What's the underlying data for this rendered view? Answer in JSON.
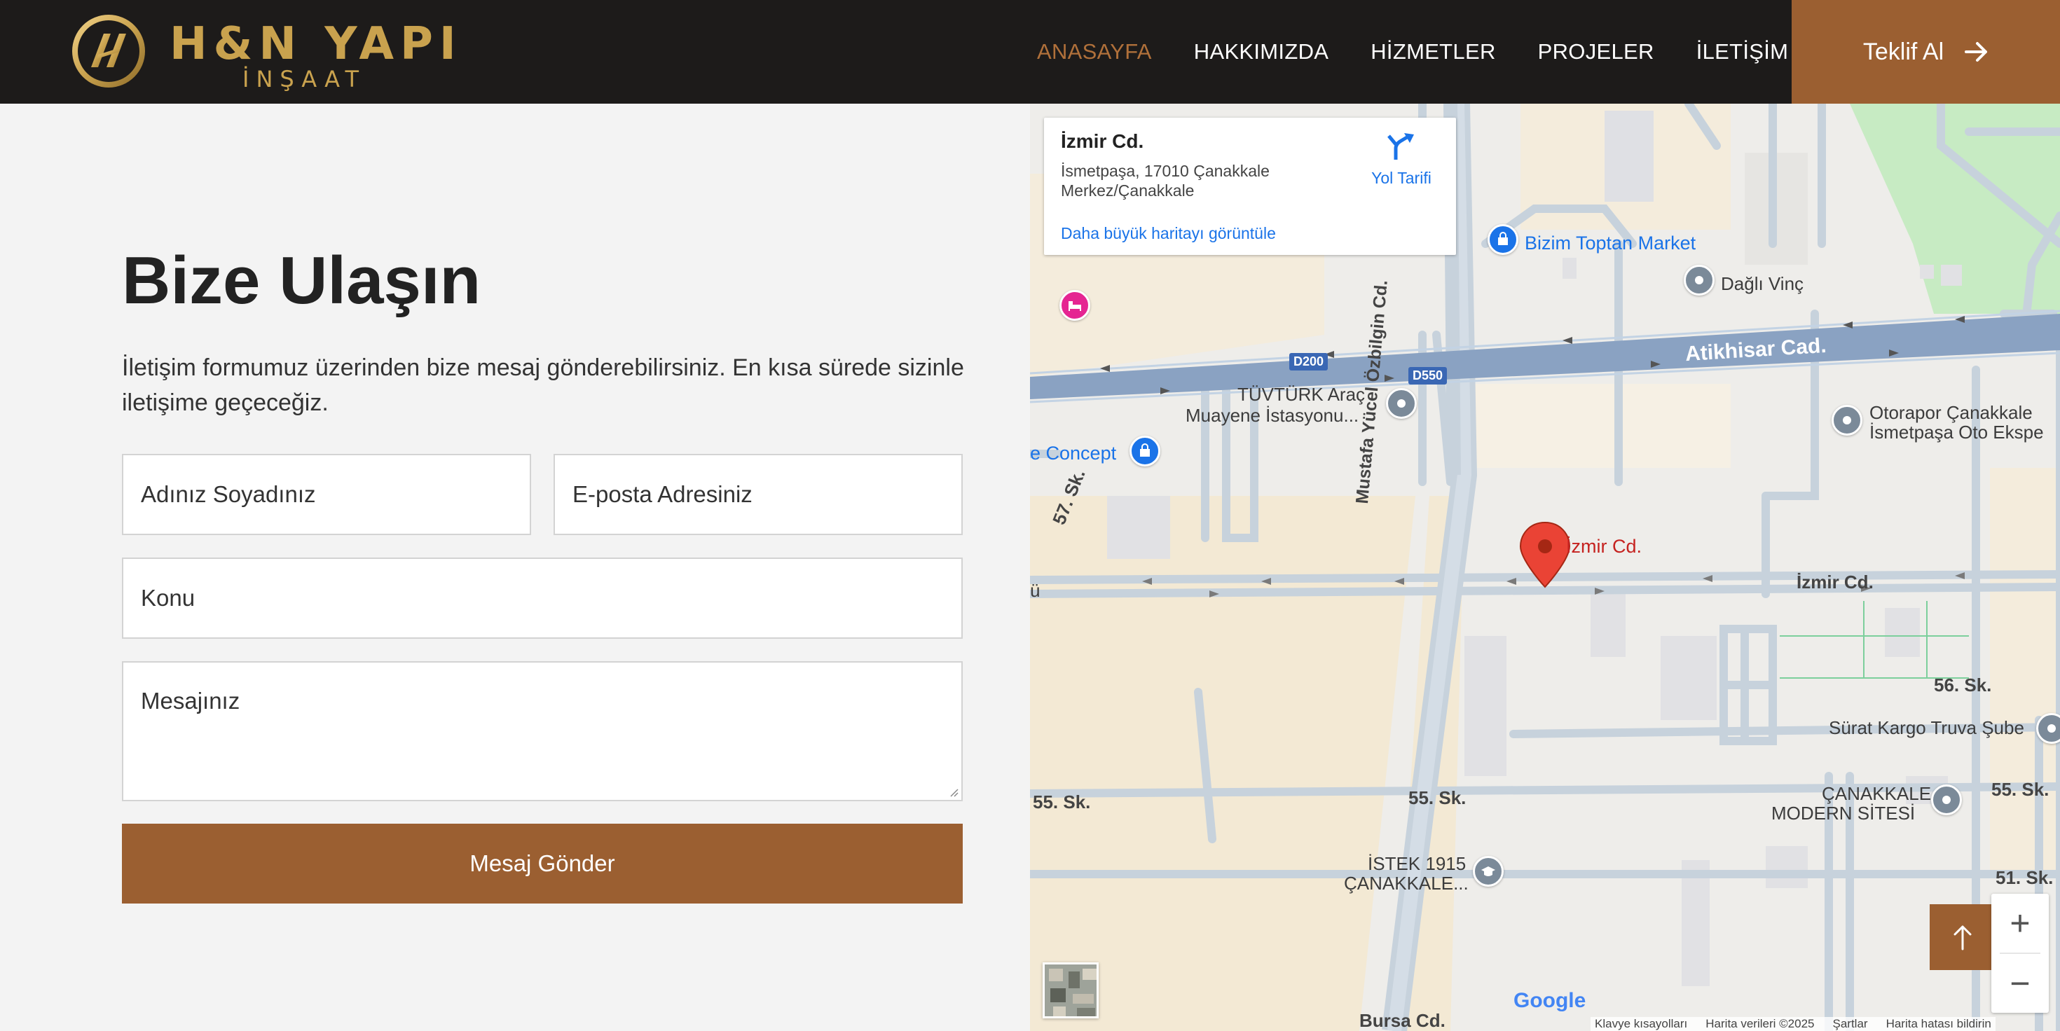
{
  "header": {
    "logo": {
      "title": "H&N YAPI",
      "subtitle": "İNŞAAT"
    },
    "nav": [
      {
        "label": "ANASAYFA",
        "active": true
      },
      {
        "label": "HAKKIMIZDA",
        "active": false
      },
      {
        "label": "HİZMETLER",
        "active": false
      },
      {
        "label": "PROJELER",
        "active": false
      },
      {
        "label": "İLETİŞİM",
        "active": false
      }
    ],
    "cta_label": "Teklif Al",
    "cta_icon": "arrow-right-icon"
  },
  "contact": {
    "title": "Bize Ulaşın",
    "description": "İletişim formumuz üzerinden bize mesaj gönderebilirsiniz. En kısa sürede sizinle iletişime geçeceğiz.",
    "fields": {
      "name_placeholder": "Adınız Soyadınız",
      "email_placeholder": "E-posta Adresiniz",
      "subject_placeholder": "Konu",
      "message_placeholder": "Mesajınız"
    },
    "submit_label": "Mesaj Gönder"
  },
  "map": {
    "info_card": {
      "title": "İzmir Cd.",
      "address_line1": "İsmetpaşa, 17010 Çanakkale",
      "address_line2": "Merkez/Çanakkale",
      "directions_label": "Yol Tarifi",
      "larger_map_link": "Daha büyük haritayı görüntüle"
    },
    "labels": {
      "atikhisar": "Atikhisar Cad.",
      "d200": "D200",
      "d550": "D550",
      "ozbilgin": "Mustafa Yücel Özbilgin Cd.",
      "izmir_marker": "İzmir Cd.",
      "izmir_street": "İzmir Cd.",
      "bizim_toptan": "Bizim Toptan Market",
      "dagli_vinc": "Dağlı Vinç",
      "tuvturk_1": "TÜVTÜRK Araç",
      "tuvturk_2": "Muayene İstasyonu...",
      "concept": "e Concept",
      "otorapor_1": "Otorapor Çanakkale",
      "otorapor_2": "İsmetpaşa Oto Ekspe",
      "sk57": "57. Sk.",
      "sk56": "56. Sk.",
      "sk55_left": "55. Sk.",
      "sk55_mid": "55. Sk.",
      "sk55_right": "55. Sk.",
      "sk51": "51. Sk.",
      "surat": "Sürat Kargo Truva Şube",
      "canakkale_modern_1": "ÇANAKKALE",
      "canakkale_modern_2": "MODERN SİTESİ",
      "istek_1": "İSTEK 1915",
      "istek_2": "ÇANAKKALE...",
      "bursa": "Bursa Cd.",
      "edge_u": "ü"
    },
    "google": "Google",
    "attribution": [
      "Klavye kısayolları",
      "Harita verileri ©2025",
      "Şartlar",
      "Harita hatası bildirin"
    ],
    "zoom_in": "+",
    "zoom_out": "−"
  }
}
